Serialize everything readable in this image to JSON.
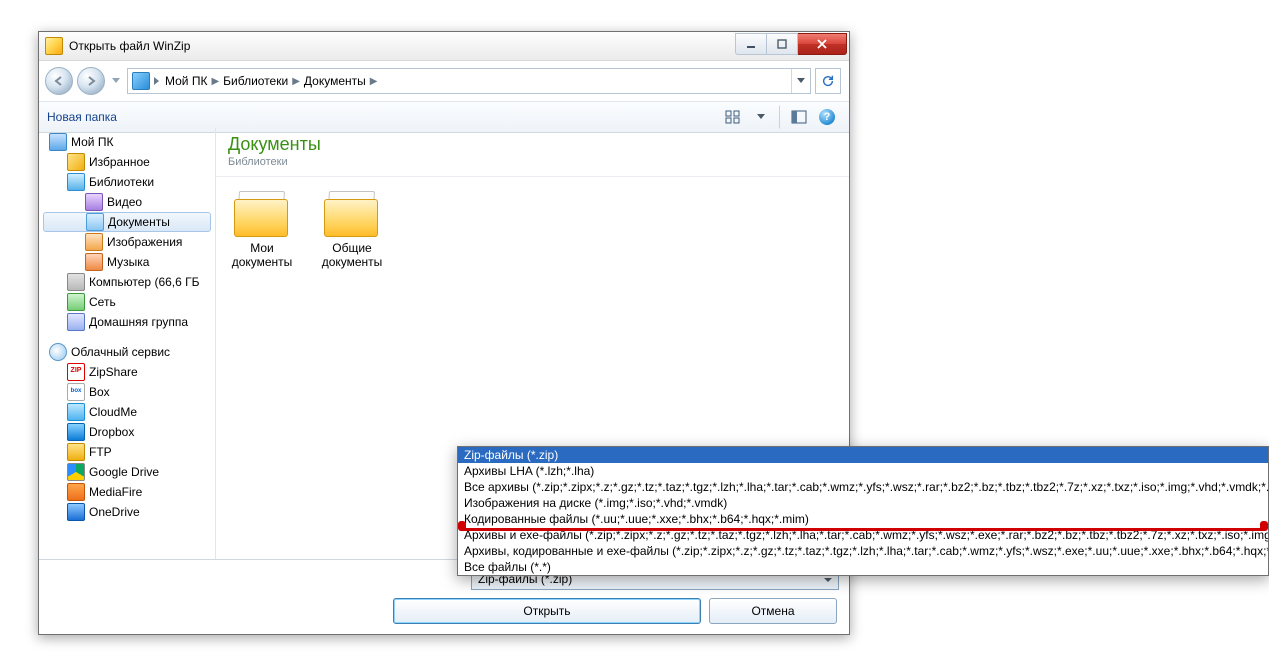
{
  "window": {
    "title": "Открыть файл WinZip"
  },
  "breadcrumb": {
    "segments": [
      "Мой ПК",
      "Библиотеки",
      "Документы"
    ]
  },
  "cmdbar": {
    "new_folder": "Новая папка"
  },
  "nav": {
    "root": {
      "label": "Мой ПК"
    },
    "fav": {
      "label": "Избранное"
    },
    "libs": {
      "label": "Библиотеки"
    },
    "video": {
      "label": "Видео"
    },
    "docs": {
      "label": "Документы"
    },
    "images": {
      "label": "Изображения"
    },
    "music": {
      "label": "Музыка"
    },
    "drive": {
      "label": "Компьютер (66,6 ГБ"
    },
    "network": {
      "label": "Сеть"
    },
    "homegroup": {
      "label": "Домашняя группа"
    },
    "cloud_header": {
      "label": "Облачный сервис"
    },
    "cloud": {
      "zipshare": {
        "label": "ZipShare"
      },
      "box": {
        "label": "Box"
      },
      "cloudme": {
        "label": "CloudMe"
      },
      "dropbox": {
        "label": "Dropbox"
      },
      "ftp": {
        "label": "FTP"
      },
      "gdrive": {
        "label": "Google Drive"
      },
      "mediafire": {
        "label": "MediaFire"
      },
      "onedrive": {
        "label": "OneDrive"
      }
    }
  },
  "content": {
    "heading": "Документы",
    "subheading": "Библиотеки",
    "items": [
      {
        "label": "Мои документы"
      },
      {
        "label": "Общие документы"
      }
    ]
  },
  "footer": {
    "filter_selected": "Zip-файлы (*.zip)",
    "open_label": "Открыть",
    "cancel_label": "Отмена"
  },
  "filter_options": [
    "Zip-файлы (*.zip)",
    "Архивы LHA (*.lzh;*.lha)",
    "Все архивы (*.zip;*.zipx;*.z;*.gz;*.tz;*.taz;*.tgz;*.lzh;*.lha;*.tar;*.cab;*.wmz;*.yfs;*.wsz;*.rar;*.bz2;*.bz;*.tbz;*.tbz2;*.7z;*.xz;*.txz;*.iso;*.img;*.vhd;*.vmdk;*.appx",
    "Изображения на диске (*.img;*.iso;*.vhd;*.vmdk)",
    "Кодированные файлы (*.uu;*.uue;*.xxe;*.bhx;*.b64;*.hqx;*.mim)",
    "Архивы и exe-файлы (*.zip;*.zipx;*.z;*.gz;*.tz;*.taz;*.tgz;*.lzh;*.lha;*.tar;*.cab;*.wmz;*.yfs;*.wsz;*.exe;*.rar;*.bz2;*.bz;*.tbz;*.tbz2;*.7z;*.xz;*.txz;*.iso;*.img;*.vh",
    "Архивы, кодированные и exe-файлы (*.zip;*.zipx;*.z;*.gz;*.tz;*.taz;*.tgz;*.lzh;*.lha;*.tar;*.cab;*.wmz;*.yfs;*.wsz;*.exe;*.uu;*.uue;*.xxe;*.bhx;*.b64;*.hqx;*.mim;*.ra",
    "Все файлы (*.*)"
  ]
}
